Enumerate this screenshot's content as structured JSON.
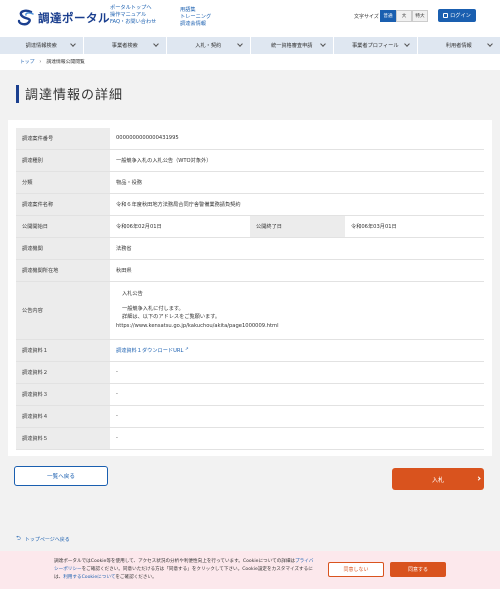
{
  "header": {
    "logo_text": "調達ポータル",
    "links_col1": [
      "ポータルトップへ",
      "操作マニュアル",
      "FAQ・お問い合わせ"
    ],
    "links_col2": [
      "用語集",
      "トレーニング",
      "調達会情報"
    ],
    "font_size_label": "文字サイズ",
    "font_sizes": [
      "普通",
      "大",
      "特大"
    ],
    "login_label": "ログイン"
  },
  "nav": {
    "items": [
      "調達情報検索",
      "事業者検索",
      "入札・契約",
      "統一資格審査申請",
      "事業者プロフィール",
      "利用者情報"
    ]
  },
  "breadcrumb": {
    "home": "トップ",
    "current": "調達情報公開閲覧"
  },
  "page_title": "調達情報の詳細",
  "detail": {
    "case_number_label": "調達案件番号",
    "case_number": "0000000000000431995",
    "type_label": "調達種別",
    "type": "一般競争入札の入札公告（WTO対象外）",
    "category_label": "分類",
    "category": "物品・役務",
    "name_label": "調達案件名称",
    "name": "令和６年度秋田地方法務局合同庁舎警備業務請負契約",
    "start_label": "公開開始日",
    "start": "令和06年02月01日",
    "end_label": "公開終了日",
    "end": "令和06年03月01日",
    "agency_label": "調達機関",
    "agency": "法務省",
    "location_label": "調達機関所在地",
    "location": "秋田県",
    "content_label": "公告内容",
    "content_lines": [
      "入札公告",
      "",
      "一般競争入札に付します。",
      "詳細は、以下のアドレスをご覧願います。"
    ],
    "content_url": "https://www.kensatsu.go.jp/kakuchou/akita/page1000009.html",
    "doc1_label": "調達資料１",
    "doc1": "調達資料１ダウンロードURL",
    "doc2_label": "調達資料２",
    "doc2": "-",
    "doc3_label": "調達資料３",
    "doc3": "-",
    "doc4_label": "調達資料４",
    "doc4": "-",
    "doc5_label": "調達資料５",
    "doc5": "-"
  },
  "buttons": {
    "back": "一覧へ戻る",
    "bid": "入札"
  },
  "pagetop": "トップページへ戻る",
  "cookie": {
    "text_part1": "調達ポータルではCookie等を使用して、アクセス状況の分析や利便性向上を行っています。Cookieについての詳細は",
    "policy_link": "プライバシーポリシー",
    "text_part2": "をご確認ください。同意いただける方は「同意する」をクリックして下さい。Cookie設定をカスタマイズするには、",
    "settings_link": "利用するCookieについて",
    "text_part3": "をご確認ください。",
    "decline": "同意しない",
    "accept": "同意する"
  },
  "colors": {
    "brand": "#1b3f8f",
    "accent_blue": "#1a5fb0",
    "accent_orange": "#d9531e",
    "cookie_bg": "#fce8ec"
  }
}
